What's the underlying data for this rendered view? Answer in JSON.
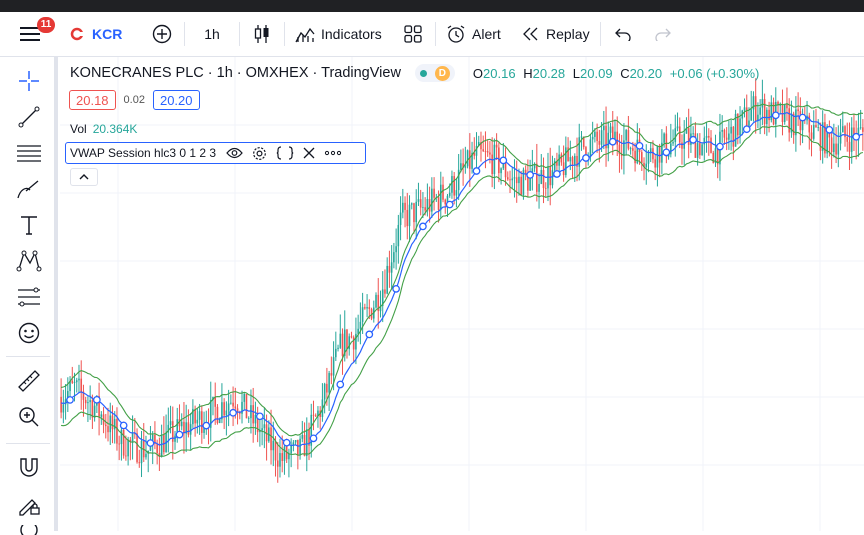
{
  "header": {
    "menu_badge": "11",
    "symbol": "KCR",
    "interval": "1h",
    "indicators_label": "Indicators",
    "alert_label": "Alert",
    "replay_label": "Replay"
  },
  "legend": {
    "title": "KONECRANES PLC · 1h · OMXHEX · TradingView",
    "delayed_badge": "D",
    "o_label": "O",
    "o_value": "20.16",
    "h_label": "H",
    "h_value": "20.28",
    "l_label": "L",
    "l_value": "20.09",
    "c_label": "C",
    "c_value": "20.20",
    "change": "+0.06 (+0.30%)",
    "sell_price": "20.18",
    "spread": "0.02",
    "buy_price": "20.20",
    "vol_label": "Vol",
    "vol_value": "20.364K",
    "vwap_label": "VWAP Session hlc3 0 1 2 3"
  },
  "colors": {
    "up": "#26a69a",
    "down": "#ef5350",
    "vwap": "#2962ff",
    "band": "#43a047",
    "accent": "#2962ff"
  },
  "icons": {
    "left_toolbar": [
      "crosshair-icon",
      "trend-line-icon",
      "horizontal-lines-icon",
      "brush-icon",
      "text-icon",
      "pattern-icon",
      "fib-icon",
      "emoji-icon",
      "ruler-icon",
      "zoom-in-icon",
      "magnet-icon",
      "lock-drawing-icon"
    ]
  },
  "chart_data": {
    "type": "candlestick",
    "title": "",
    "series": [
      {
        "name": "KONECRANES PLC"
      },
      {
        "name": "VWAP"
      }
    ],
    "close_path": [
      [
        0,
        20.0
      ],
      [
        4,
        20.2
      ],
      [
        10,
        19.8
      ],
      [
        18,
        19.0
      ],
      [
        26,
        18.8
      ],
      [
        34,
        19.2
      ],
      [
        44,
        19.6
      ],
      [
        52,
        20.0
      ],
      [
        58,
        19.4
      ],
      [
        66,
        18.6
      ],
      [
        72,
        18.8
      ],
      [
        78,
        19.8
      ],
      [
        84,
        21.2
      ],
      [
        88,
        21.4
      ],
      [
        96,
        22.4
      ],
      [
        102,
        24.0
      ],
      [
        108,
        24.2
      ],
      [
        116,
        24.6
      ],
      [
        124,
        25.4
      ],
      [
        130,
        25.3
      ],
      [
        136,
        24.8
      ],
      [
        148,
        25.0
      ],
      [
        156,
        25.6
      ],
      [
        166,
        25.8
      ],
      [
        176,
        25.4
      ],
      [
        186,
        25.8
      ],
      [
        196,
        25.5
      ],
      [
        208,
        26.5
      ],
      [
        214,
        26.3
      ],
      [
        224,
        26.0
      ],
      [
        230,
        25.7
      ],
      [
        240,
        25.9
      ]
    ],
    "vwap_markers": 30
  }
}
